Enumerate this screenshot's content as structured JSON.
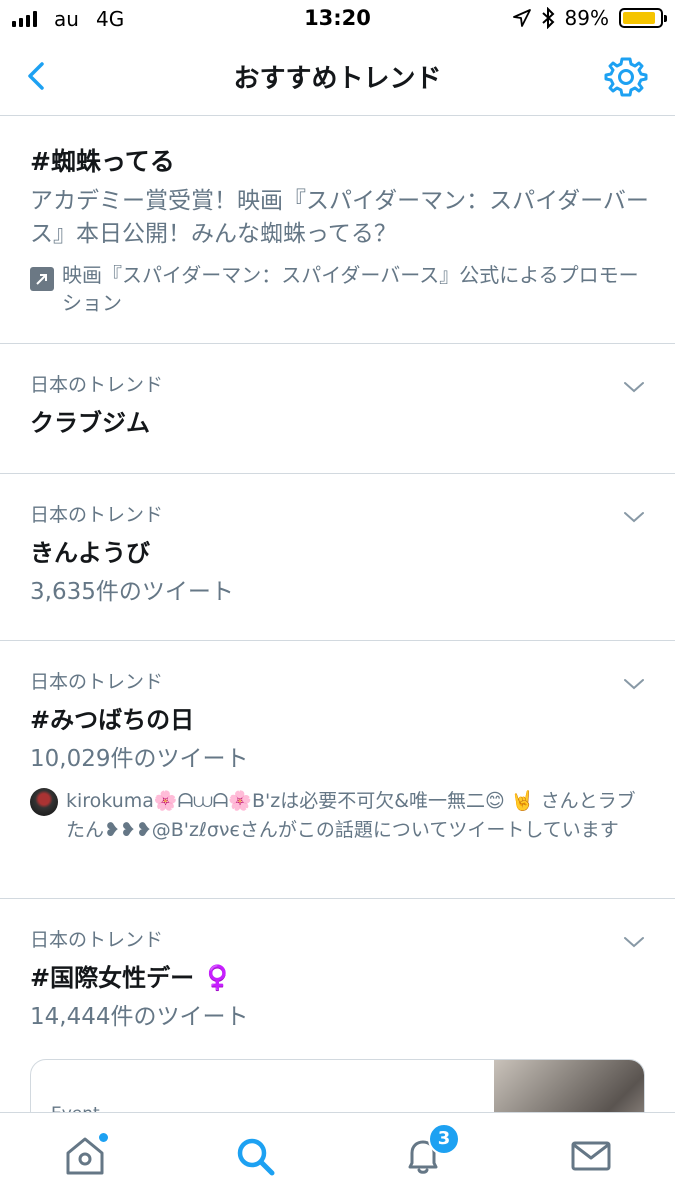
{
  "status_bar": {
    "carrier": "au",
    "network": "4G",
    "time": "13:20",
    "battery_percent": "89%",
    "battery_level": 0.89,
    "icons": [
      "signal-icon",
      "location-arrow-icon",
      "bluetooth-icon",
      "battery-icon"
    ]
  },
  "nav": {
    "title": "おすすめトレンド",
    "back_icon": "chevron-left-icon",
    "settings_icon": "gear-icon",
    "accent_color": "#1da1f2"
  },
  "promoted": {
    "hashtag": "#蜘蛛ってる",
    "description": "アカデミー賞受賞！映画『スパイダーマン：スパイダーバース』本日公開！みんな蜘蛛ってる？",
    "promoted_by": "映画『スパイダーマン：スパイダーバース』公式によるプロモーション",
    "icon": "promoted-arrow-icon"
  },
  "trends": [
    {
      "context": "日本のトレンド",
      "name": "クラブジム"
    },
    {
      "context": "日本のトレンド",
      "name": "きんようび",
      "count": "3,635件のツイート"
    },
    {
      "context": "日本のトレンド",
      "name": "#みつばちの日",
      "count": "10,029件のツイート",
      "social": "kirokuma🌸ᗩ⩊ᗩ🌸B'zは必要不可欠&唯一無二😊 🤘 さんとラブたん❥❥❥@B'zℓσνєさんがこの話題についてツイートしています"
    },
    {
      "context": "日本のトレンド",
      "name": "#国際女性デー ♀️",
      "count": "14,444件のツイート",
      "event_label": "Event"
    }
  ],
  "tab_bar": {
    "items": [
      "home-icon",
      "search-icon",
      "bell-icon",
      "mail-icon"
    ],
    "notification_badge": "3"
  }
}
